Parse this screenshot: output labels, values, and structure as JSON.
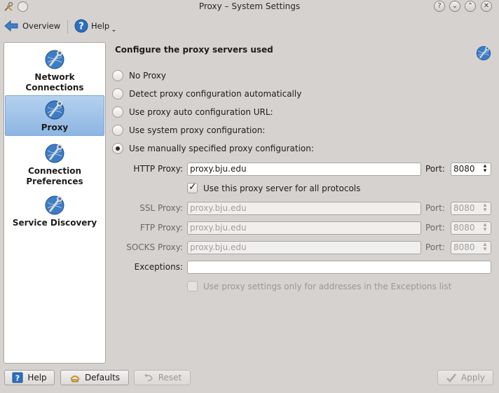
{
  "window": {
    "title": "Proxy – System Settings",
    "buttons": [
      "?",
      "⌄",
      "⌃",
      "✕"
    ]
  },
  "toolbar": {
    "overview_label": "Overview",
    "help_label": "Help"
  },
  "sidebar": {
    "items": [
      {
        "label": "Network Connections",
        "selected": false
      },
      {
        "label": "Proxy",
        "selected": true
      },
      {
        "label": "Connection Preferences",
        "selected": false
      },
      {
        "label": "Service Discovery",
        "selected": false
      }
    ]
  },
  "main": {
    "heading": "Configure the proxy servers used",
    "mode_options": [
      "No Proxy",
      "Detect proxy configuration automatically",
      "Use proxy auto configuration URL:",
      "Use system proxy configuration:",
      "Use manually specified proxy configuration:"
    ],
    "selected_mode": "Use manually specified proxy configuration:",
    "http": {
      "label": "HTTP Proxy:",
      "value": "proxy.bju.edu",
      "port_label": "Port:",
      "port": "8080"
    },
    "use_for_all": {
      "label": "Use this proxy server for all protocols",
      "checked": true
    },
    "ssl": {
      "label": "SSL Proxy:",
      "value": "proxy.bju.edu",
      "port_label": "Port:",
      "port": "8080"
    },
    "ftp": {
      "label": "FTP Proxy:",
      "value": "proxy.bju.edu",
      "port_label": "Port:",
      "port": "8080"
    },
    "socks": {
      "label": "SOCKS Proxy:",
      "value": "proxy.bju.edu",
      "port_label": "Port:",
      "port": "8080"
    },
    "exceptions": {
      "label": "Exceptions:",
      "value": ""
    },
    "exceptions_only": {
      "label": "Use proxy settings only for addresses in the Exceptions list",
      "checked": false
    }
  },
  "footer": {
    "help_label": "Help",
    "defaults_label": "Defaults",
    "reset_label": "Reset",
    "apply_label": "Apply"
  },
  "icons": {
    "app": "settings-tools-icon",
    "nav_back": "arrow-left-icon",
    "help": "help-icon",
    "network": "network-wrench-globe-icon"
  },
  "colors": {
    "window_bg": "#d6d2d0",
    "selection": "#8cb6e3",
    "globe": "#3e7cc4"
  }
}
